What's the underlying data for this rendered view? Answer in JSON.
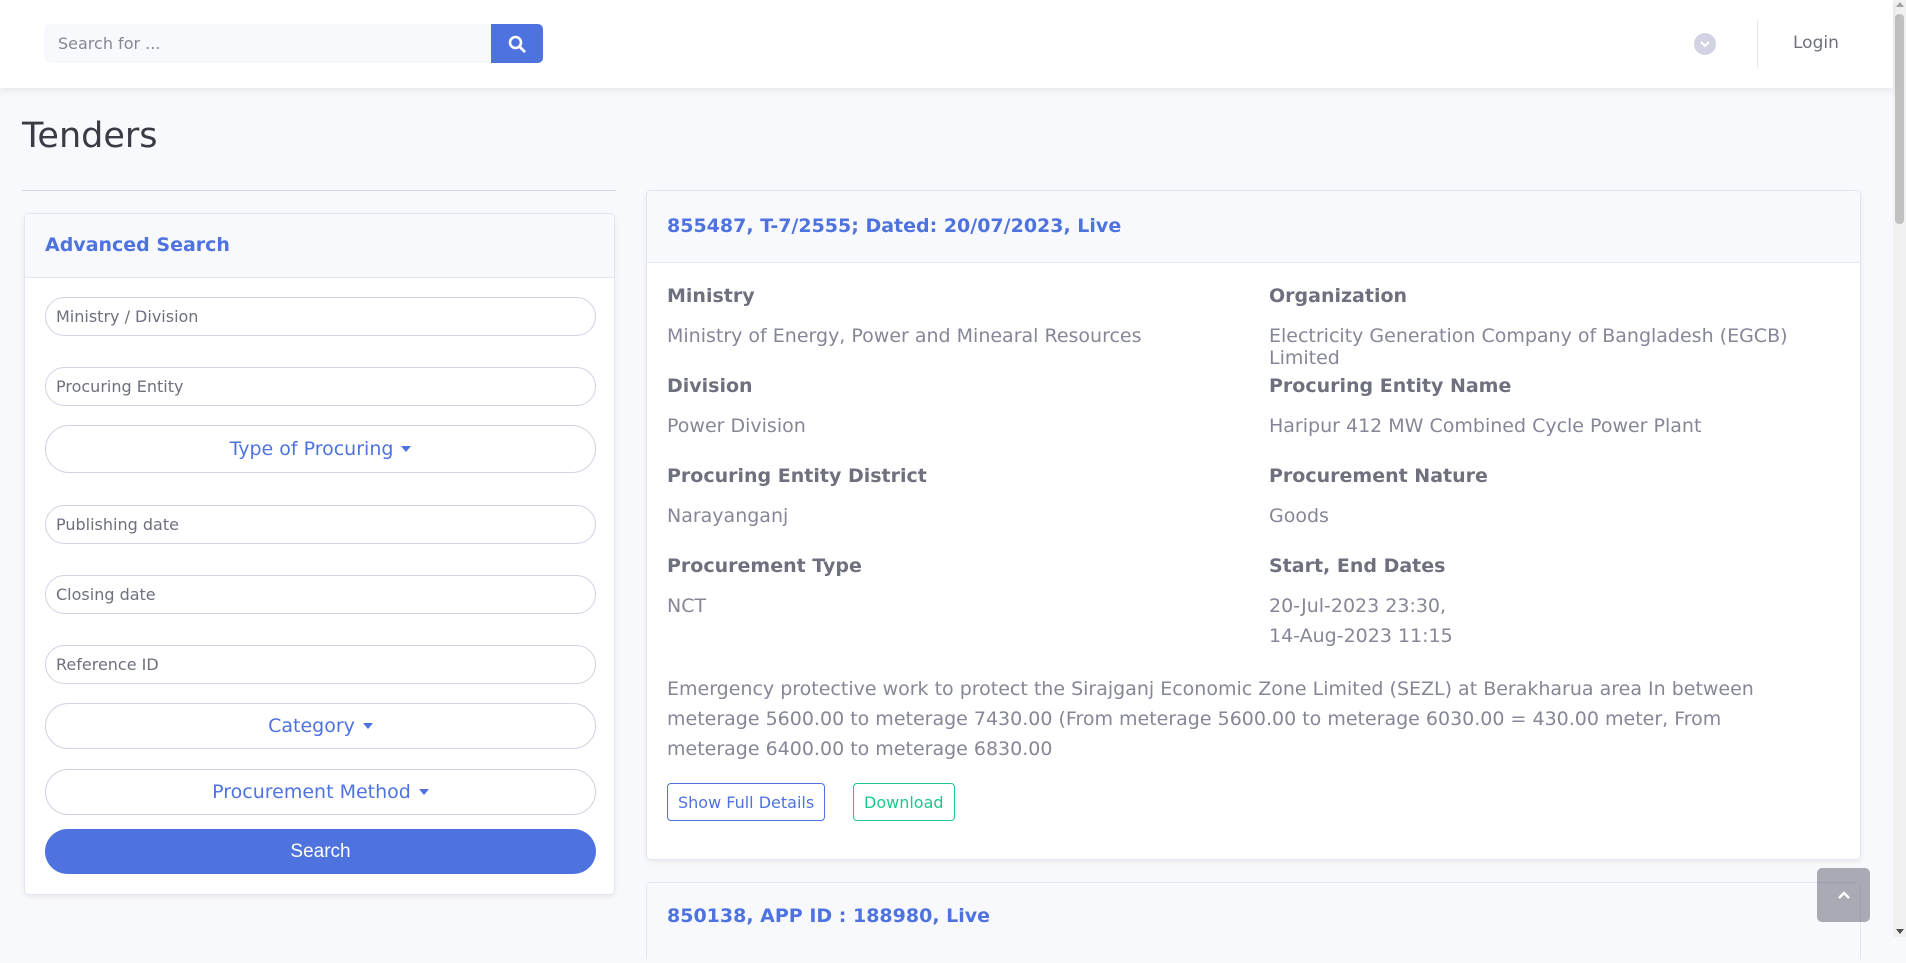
{
  "topbar": {
    "search_placeholder": "Search for ...",
    "login_label": "Login"
  },
  "page": {
    "title": "Tenders"
  },
  "advanced_search": {
    "title": "Advanced Search",
    "ministry_placeholder": "Ministry / Division",
    "procuring_entity_placeholder": "Procuring Entity",
    "type_of_procuring_label": "Type of Procuring",
    "publishing_date_placeholder": "Publishing date",
    "closing_date_placeholder": "Closing date",
    "reference_id_placeholder": "Reference ID",
    "category_label": "Category",
    "procurement_method_label": "Procurement Method",
    "search_label": "Search"
  },
  "tenders": [
    {
      "title": "855487, T-7/2555; Dated: 20/07/2023, Live",
      "ministry_label": "Ministry",
      "ministry": "Ministry of Energy, Power and Minearal Resources",
      "organization_label": "Organization",
      "organization": "Electricity Generation Company of Bangladesh (EGCB) Limited",
      "division_label": "Division",
      "division": "Power Division",
      "procuring_entity_name_label": "Procuring Entity Name",
      "procuring_entity_name": "Haripur 412 MW Combined Cycle Power Plant",
      "district_label": "Procuring Entity District",
      "district": "Narayanganj",
      "nature_label": "Procurement Nature",
      "nature": "Goods",
      "type_label": "Procurement Type",
      "type": "NCT",
      "dates_label": "Start, End Dates",
      "start_date": "20-Jul-2023 23:30,",
      "end_date": "14-Aug-2023 11:15",
      "description": "Emergency protective work to protect the Sirajganj Economic Zone Limited (SEZL) at Berakharua area In between meterage 5600.00 to meterage 7430.00 (From meterage 5600.00 to meterage 6030.00 = 430.00 meter, From meterage 6400.00 to meterage 6830.00",
      "show_details_label": "Show Full Details",
      "download_label": "Download"
    },
    {
      "title": "850138, APP ID : 188980, Live"
    }
  ],
  "colors": {
    "primary": "#4e73df",
    "success": "#1cc88a",
    "background": "#f8f9fc"
  }
}
